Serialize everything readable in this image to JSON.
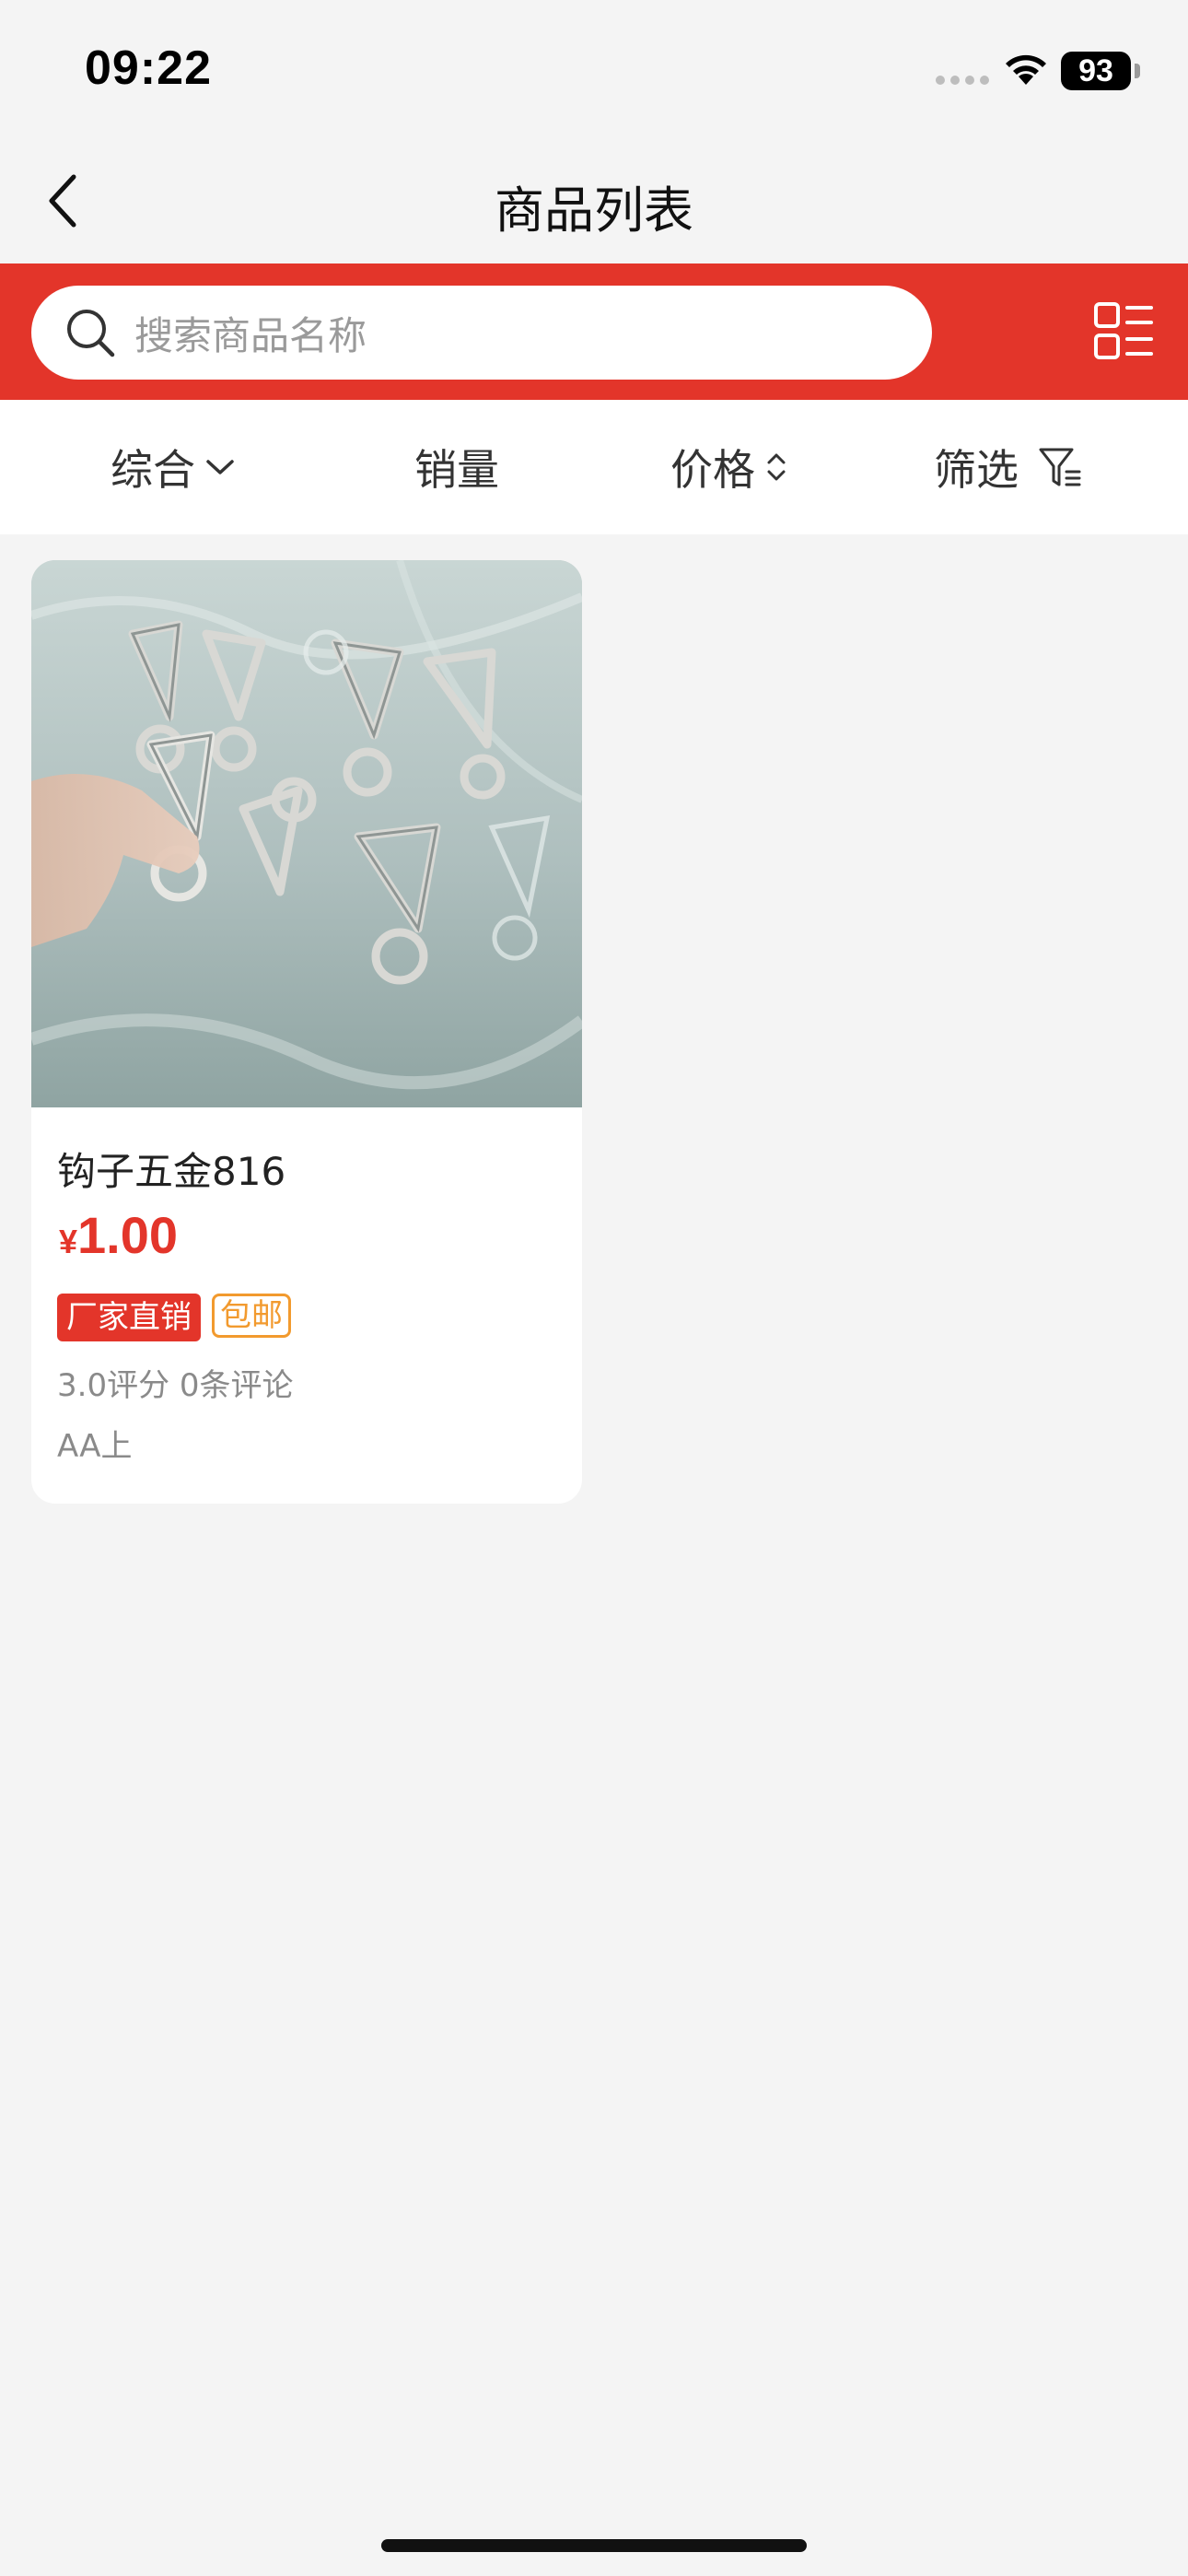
{
  "status_bar": {
    "time": "09:22",
    "battery": "93"
  },
  "nav": {
    "title": "商品列表",
    "back_icon": "chevron-left-icon"
  },
  "search": {
    "placeholder": "搜索商品名称",
    "icon": "search-icon",
    "layout_toggle_icon": "grid-list-icon"
  },
  "filters": [
    {
      "label": "综合",
      "icon": "chevron-down-icon"
    },
    {
      "label": "销量"
    },
    {
      "label": "价格",
      "icon": "sort-updown-icon"
    },
    {
      "label": "筛选",
      "icon": "filter-icon"
    }
  ],
  "products": [
    {
      "name": "钩子五金816",
      "price_symbol": "¥",
      "price": "1.00",
      "tags": [
        "厂家直销",
        "包邮"
      ],
      "rating": "3.0评分  0条评论",
      "shop": "AA上"
    }
  ],
  "colors": {
    "brand_red": "#e3352a",
    "tag_orange": "#f29a2e",
    "background": "#f4f4f4"
  }
}
